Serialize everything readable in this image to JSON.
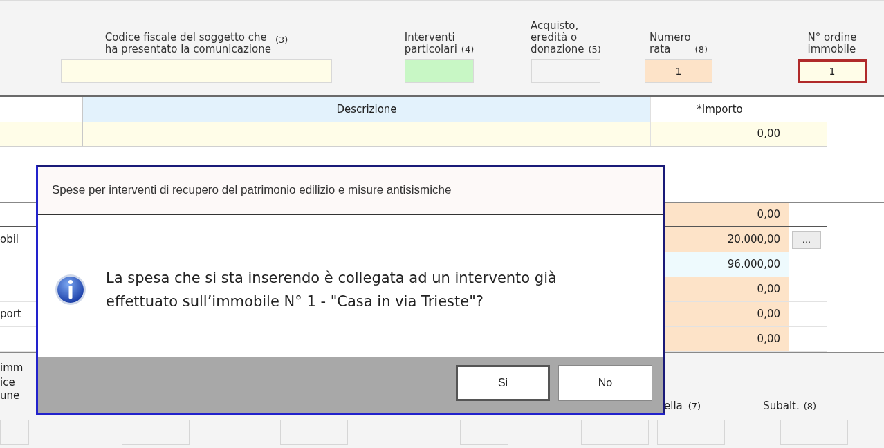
{
  "header_fields": [
    {
      "label_lines": [
        "Codice fiscale del soggetto che",
        "ha presentato la comunicazione"
      ],
      "note": "(3)",
      "color": "#fffde8",
      "focused": false
    },
    {
      "label_lines": [
        "Interventi",
        "particolari"
      ],
      "note": "(4)",
      "color": "#c8f7c5",
      "focused": false
    },
    {
      "label_lines": [
        "Acquisto,",
        "eredità o",
        "donazione"
      ],
      "note": "(5)",
      "color": "#f4f4f4",
      "focused": false
    },
    {
      "label_lines": [
        "Numero",
        "rata"
      ],
      "note": "(8)",
      "color": "#fde3c8",
      "value": "1",
      "focused": false
    },
    {
      "label_lines": [
        "N° ordine",
        "immobile"
      ],
      "color": "#fffde8",
      "value": "1",
      "focused": true
    }
  ],
  "table": {
    "columns": [
      "Descrizione",
      "*Importo"
    ],
    "rows": [
      {
        "importo": "0,00"
      }
    ]
  },
  "amounts": [
    {
      "value": "0,00",
      "color": "#fde3c8"
    },
    {
      "label": "obil",
      "value": "20.000,00",
      "color": "#fde3c8",
      "button": "..."
    },
    {
      "value": "96.000,00",
      "color": "#eefafd"
    },
    {
      "value": "0,00",
      "color": "#fde3c8"
    },
    {
      "label": "port",
      "value": "0,00",
      "color": "#fde3c8"
    },
    {
      "value": "0,00",
      "color": "#fde3c8"
    }
  ],
  "bottom": {
    "labels_left": [
      "imm",
      "ice",
      "une"
    ],
    "label_foglio": "ella",
    "note_foglio": "(7)",
    "label_subalt": "Subalt.",
    "note_subalt": "(8)"
  },
  "dialog": {
    "title": "Spese per interventi di recupero del patrimonio edilizio e misure antisismiche",
    "message_lines": [
      "La spesa che si sta inserendo è collegata ad un intervento già",
      "effettuato sull’immobile N° 1 - \"Casa in via Trieste\"?"
    ],
    "buttons": [
      {
        "label": "Si",
        "default": true
      },
      {
        "label": "No",
        "default": false
      }
    ]
  }
}
